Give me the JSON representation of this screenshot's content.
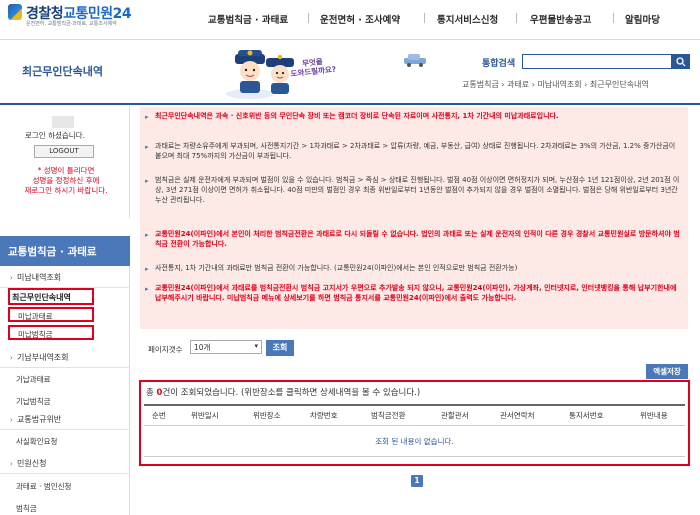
{
  "header": {
    "logo_main": "경찰청",
    "logo_accent": "교통민원24",
    "logo_sub": "운전면허, 교통범칙금·과태료, 교통조사예약",
    "nav": [
      "교통범칙금 · 과태료",
      "운전면허 · 조사예약",
      "통지서비스신청",
      "우편물반송공고",
      "알림마당"
    ]
  },
  "page": {
    "title": "최근무인단속내역",
    "mascot_bubble": "무엇을\n도와드릴까요?",
    "search_label": "통합검색",
    "search_placeholder": "",
    "breadcrumb": "교통범칙금 › 과태료 › 미납내역조회 › 최근무인단속내역"
  },
  "login": {
    "greeting": "로그인 하셨습니다.",
    "logout": "LOGOUT",
    "notice": "* 성명이 틀리다면\n성명을 정정하신 후에\n재로그인 하시기 바랍니다."
  },
  "sidebar": {
    "heading": "교통범칙금 · 과태료",
    "items": [
      {
        "label": "미납내역조회"
      },
      {
        "label": "최근무인단속내역"
      },
      {
        "label": "미납과태료"
      },
      {
        "label": "미납범칙금"
      },
      {
        "label": "기납부내역조회"
      },
      {
        "label": "기납과태료"
      },
      {
        "label": "기납범칙금"
      },
      {
        "label": "교통법규위반"
      },
      {
        "label": "사실확인요청"
      },
      {
        "label": "민원신청"
      },
      {
        "label": "과태료 · 범인신청"
      },
      {
        "label": "범칙금"
      }
    ]
  },
  "info": [
    {
      "text": "최근무인단속내역은 과속 · 신호위반 등의 무인단속 장비 또는 캠코더 장비로 단속된 자료이며 사전통지, 1차 기간내의 미납과태료입니다.",
      "red": true
    },
    {
      "text": "과태료는 차량소유주에게 부과되며, 사전통지기간 > 1차과태료 > 2차과태료 > 압류(차량, 예금, 부동산, 급여) 상태로 진행됩니다. 2차과태료는 3%의 가산금, 1.2% 중가산금이 붙으며 최대 75%까지의 가산금이 부과됩니다.",
      "red": false
    },
    {
      "text": "범칙금은 실제 운전자에게 부과되며 벌점이 있을 수 있습니다. 범칙금 > 즉심 > 상태로 진행됩니다. 벌점 40점 이상이면 면허정지가 되며, 누산점수 1년 121점이상, 2년 201점 이상, 3년 271점 이상이면 면허가 취소됩니다. 40점 미만의 벌점인 경우 최종 위반일로부터 1년동안 벌점이 추가되지 않을 경우 벌점이 소멸됩니다. 벌점은 당해 위반일로부터 3년간 누산 관리됩니다.",
      "red": false
    },
    {
      "text": "교통민원24(이파인)에서 본인이 처리한 범칙금전환은 과태료로 다시 되돌릴 수 없습니다. 법인의 과태료 또는 실제 운전자의 인적이 다른 경우 경찰서 교통민원실로 방문하셔야 범칙금 전환이 가능합니다.",
      "red": true
    },
    {
      "text": "사전통지, 1차 기간내의 과태료만 범칙금 전환이 가능합니다. (교통민원24(이파인)에서는 본인 인적으로만 범칙금 전환가능)",
      "red": false
    },
    {
      "text": "교통민원24(이파인)에서 과태료를 범칙금전환시 범칙금 고지서가 우편으로 추가발송 되지 않으니, 교통민원24(이파인), 가상계좌, 인터넷지로, 인터넷뱅킹을 통해 납부기한내에 납부해주시기 바랍니다. 미납범칙금 메뉴에 상세보기를 하면 범칙금 통지서를 교통민원24(이파인)에서 출력도 가능합니다.",
      "red": true
    }
  ],
  "controls": {
    "page_size_label": "페이지갯수",
    "page_size_value": "10개",
    "query": "조회",
    "excel": "엑셀저장"
  },
  "results": {
    "summary_prefix": "총 ",
    "count": "0",
    "summary_suffix": "건이 조회되었습니다. (위반장소를 클릭하면 상세내역을 볼 수 있습니다.)",
    "columns": [
      "순번",
      "위반일시",
      "위반장소",
      "차량번호",
      "범칙금전환",
      "관할관서",
      "관서연락처",
      "통지서번호",
      "위반내용"
    ],
    "empty": "조회 된 내용이 없습니다."
  },
  "pagination": {
    "current": "1"
  },
  "colors": {
    "brand": "#2b5797",
    "accent": "#4a78b8",
    "alert": "#e0001b",
    "info_bg": "#fde9e5"
  }
}
